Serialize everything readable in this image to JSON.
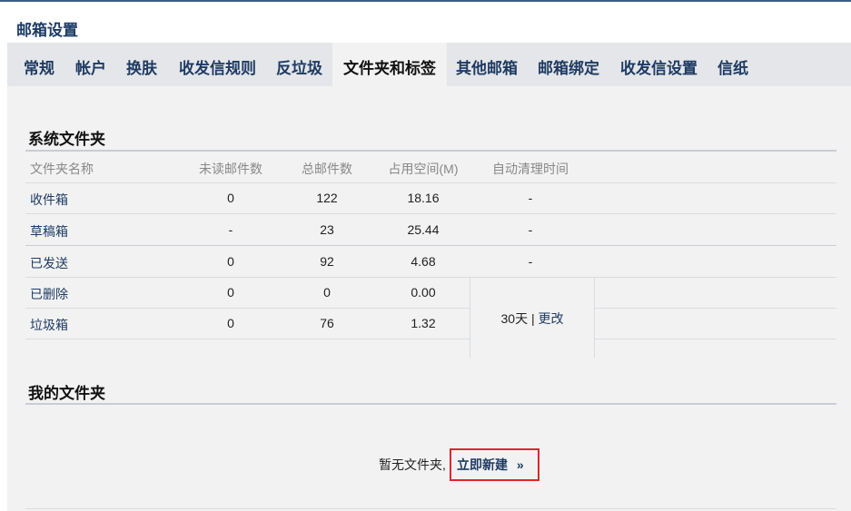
{
  "page": {
    "title": "邮箱设置"
  },
  "tabs": [
    {
      "label": "常规"
    },
    {
      "label": "帐户"
    },
    {
      "label": "换肤"
    },
    {
      "label": "收发信规则"
    },
    {
      "label": "反垃圾"
    },
    {
      "label": "文件夹和标签",
      "active": true
    },
    {
      "label": "其他邮箱"
    },
    {
      "label": "邮箱绑定"
    },
    {
      "label": "收发信设置"
    },
    {
      "label": "信纸"
    }
  ],
  "system_folders": {
    "title": "系统文件夹",
    "headers": [
      "文件夹名称",
      "未读邮件数",
      "总邮件数",
      "占用空间(M)",
      "自动清理时间"
    ],
    "rows": [
      {
        "name": "收件箱",
        "unread": "0",
        "total": "122",
        "space": "18.16",
        "cleanup": "-"
      },
      {
        "name": "草稿箱",
        "unread": "-",
        "total": "23",
        "space": "25.44",
        "cleanup": "-"
      },
      {
        "name": "已发送",
        "unread": "0",
        "total": "92",
        "space": "4.68",
        "cleanup": "-"
      },
      {
        "name": "已删除",
        "unread": "0",
        "total": "0",
        "space": "0.00"
      },
      {
        "name": "垃圾箱",
        "unread": "0",
        "total": "76",
        "space": "1.32"
      }
    ],
    "merged_cleanup": {
      "days": "30天",
      "separator": " | ",
      "change": "更改"
    }
  },
  "my_folders": {
    "title": "我的文件夹",
    "empty_text": "暂无文件夹,",
    "create_label": "立即新建",
    "create_arrow": "»"
  },
  "colors": {
    "accent": "#1f3b63",
    "highlight": "#e0252b",
    "tabbar": "#e4e6e9",
    "panel": "#f2f2f2"
  }
}
